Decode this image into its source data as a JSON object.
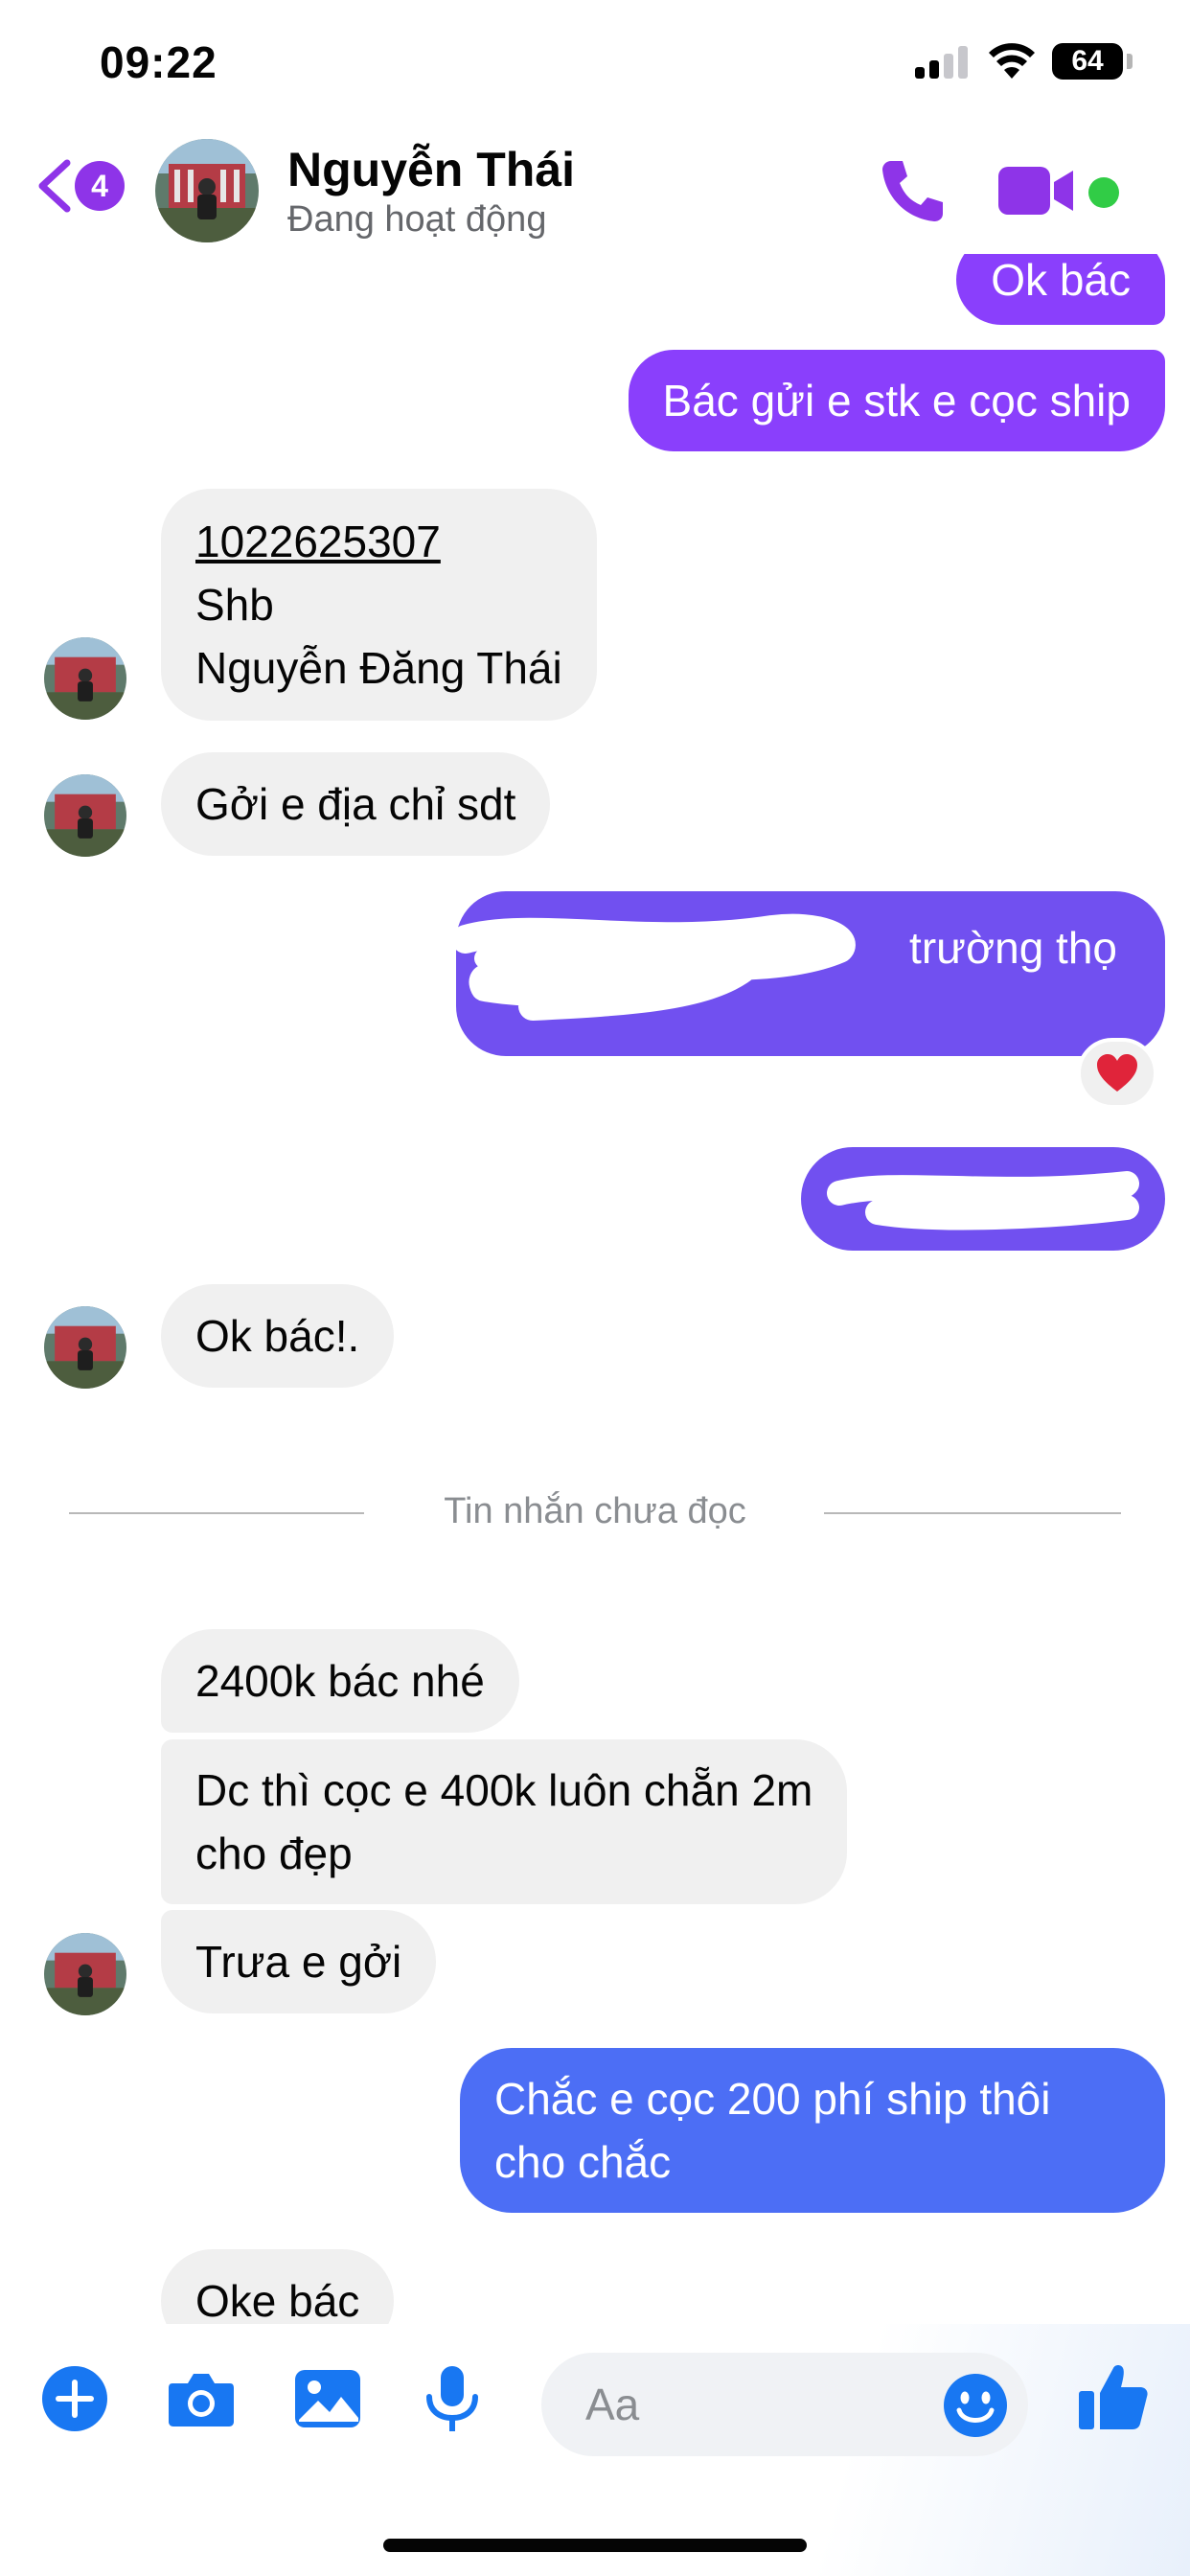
{
  "status_bar": {
    "time": "09:22",
    "battery": "64"
  },
  "header": {
    "unread_badge": "4",
    "contact_name": "Nguyễn Thái",
    "contact_status": "Đang hoạt động"
  },
  "messages": {
    "m1": "Ok bác",
    "m2": "Bác gửi e stk e cọc ship",
    "m3": [
      "1022625307",
      "Shb",
      "Nguyễn Đăng Thái"
    ],
    "m4": "Gởi e địa chỉ sdt",
    "m5_visible": "trường thọ",
    "m7": "Ok bác!.",
    "unread_divider": "Tin nhắn chưa đọc",
    "m8": "2400k bác nhé",
    "m9": [
      "Dc thì cọc e 400k luôn chẵn 2m",
      "cho đẹp"
    ],
    "m10": "Trưa e gởi",
    "m11": [
      "Chắc e cọc 200 phí ship thôi",
      "cho chắc"
    ],
    "m12": "Oke bác"
  },
  "composer": {
    "placeholder": "Aa"
  },
  "colors": {
    "accent_purple": "#8a3ffc",
    "outgoing_blue": "#4c6ef5",
    "icon_blue": "#1877f2",
    "incoming_gray": "#f0f0f0",
    "online_green": "#31cc46"
  }
}
